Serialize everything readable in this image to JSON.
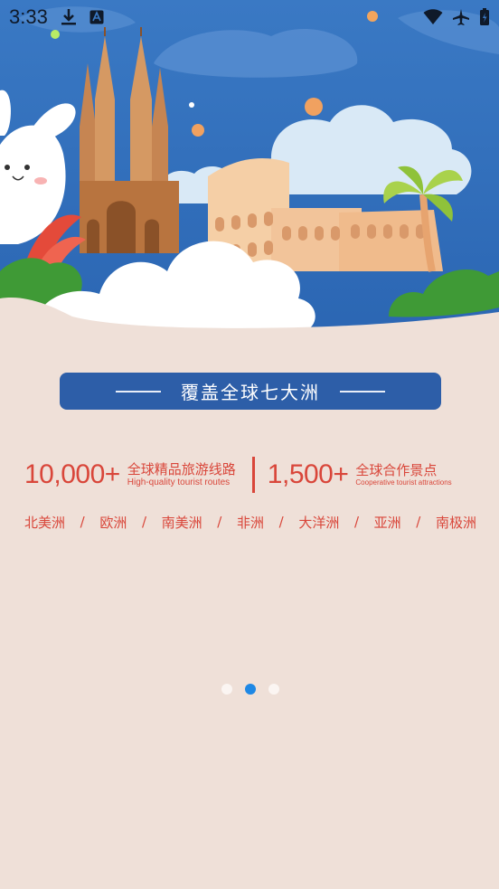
{
  "status_bar": {
    "time": "3:33",
    "left_icons": [
      "download-icon",
      "text-a-icon"
    ],
    "right_icons": [
      "wifi-icon",
      "airplane-icon",
      "battery-icon"
    ]
  },
  "hero": {
    "description_icons": [
      "bunny-icon",
      "cathedral-icon",
      "colosseum-icon",
      "palm-tree-icon",
      "cloud-icon"
    ]
  },
  "banner": {
    "title": "覆盖全球七大洲",
    "color": "#2d5ea8"
  },
  "stats": {
    "routes": {
      "number": "10,000+",
      "title": "全球精品旅游线路",
      "subtitle": "High-quality tourist routes"
    },
    "attractions": {
      "number": "1,500+",
      "title": "全球合作景点",
      "subtitle": "Cooperative tourist attractions"
    },
    "accent_color": "#d9463a"
  },
  "continents": {
    "items": [
      "北美洲",
      "欧洲",
      "南美洲",
      "非洲",
      "大洋洲",
      "亚洲",
      "南极洲"
    ],
    "separator": "/"
  },
  "pager": {
    "total": 3,
    "active_index": 1,
    "active_color": "#1e88e5"
  },
  "colors": {
    "background": "#efe0d8",
    "sky": "#2f6fba"
  }
}
